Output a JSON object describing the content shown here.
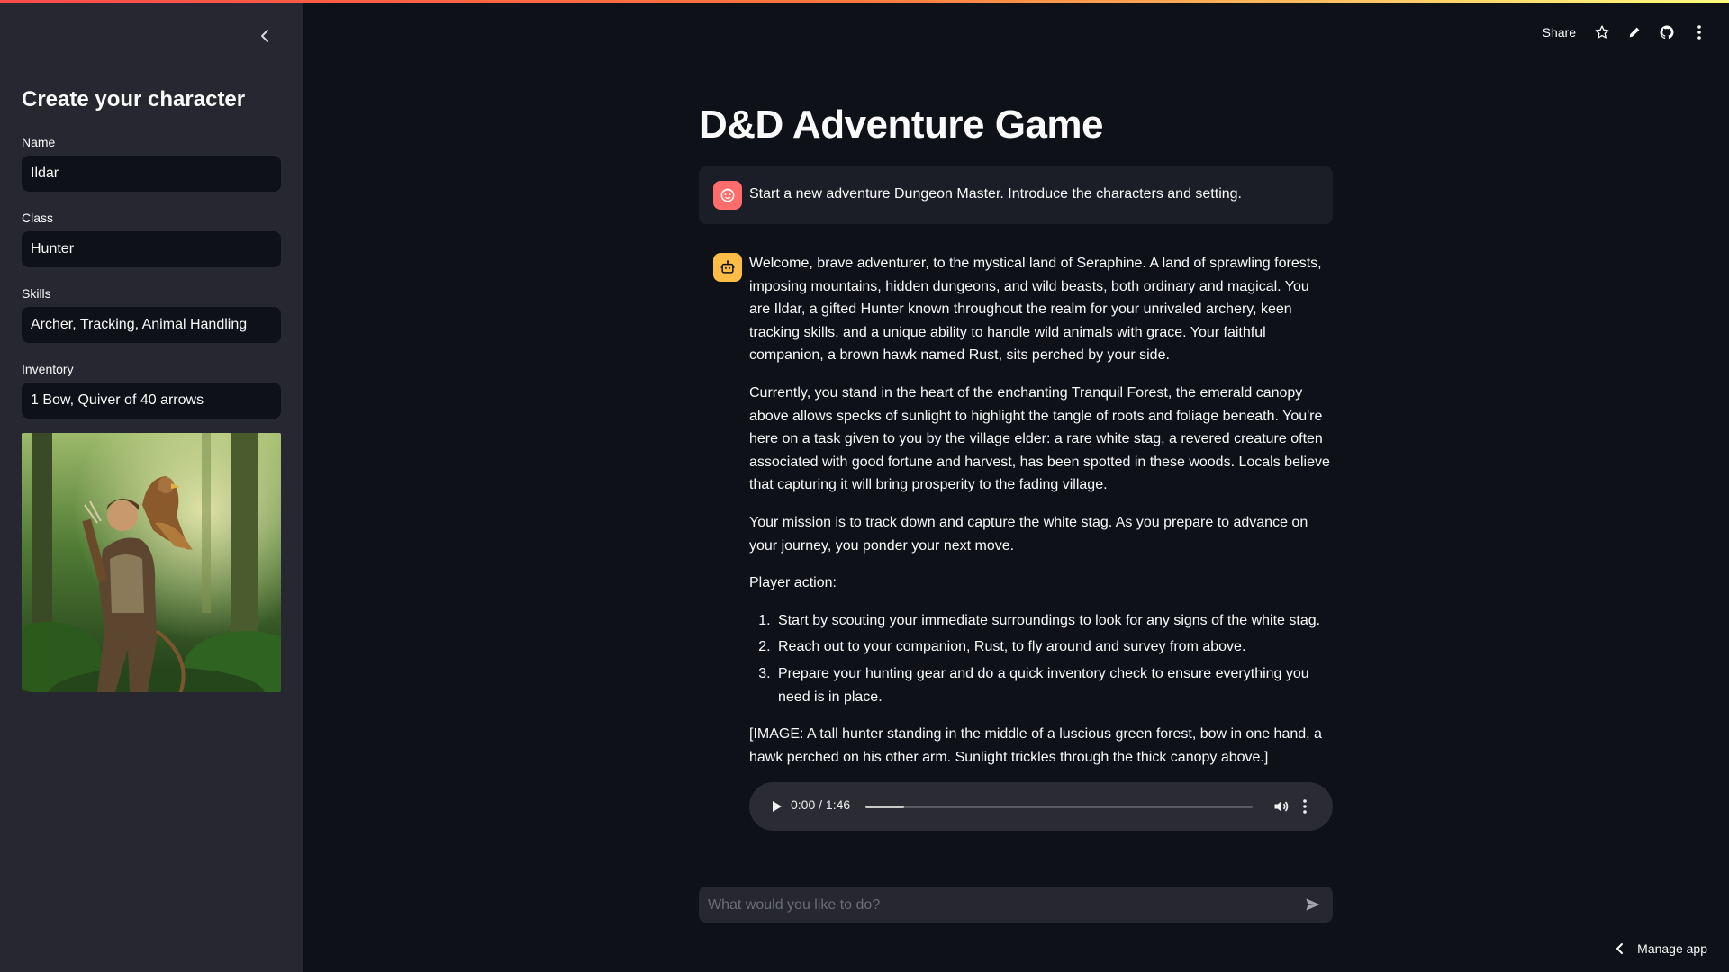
{
  "header": {
    "share_label": "Share",
    "icons": [
      "star-icon",
      "pencil-icon",
      "github-icon",
      "more-vertical-icon"
    ]
  },
  "sidebar": {
    "title": "Create your character",
    "fields": [
      {
        "label": "Name",
        "value": "Ildar"
      },
      {
        "label": "Class",
        "value": "Hunter"
      },
      {
        "label": "Skills",
        "value": "Archer, Tracking, Animal Handling"
      },
      {
        "label": "Inventory",
        "value": "1 Bow, Quiver of 40 arrows"
      }
    ],
    "portrait_icon": "hunter-with-hawk-image"
  },
  "main": {
    "title": "D&D Adventure Game",
    "user_message": "Start a new adventure Dungeon Master. Introduce the characters and setting.",
    "assistant": {
      "paragraphs": [
        "Welcome, brave adventurer, to the mystical land of Seraphine. A land of sprawling forests, imposing mountains, hidden dungeons, and wild beasts, both ordinary and magical. You are Ildar, a gifted Hunter known throughout the realm for your unrivaled archery, keen tracking skills, and a unique ability to handle wild animals with grace. Your faithful companion, a brown hawk named Rust, sits perched by your side.",
        "Currently, you stand in the heart of the enchanting Tranquil Forest, the emerald canopy above allows specks of sunlight to highlight the tangle of roots and foliage beneath. You're here on a task given to you by the village elder: a rare white stag, a revered creature often associated with good fortune and harvest, has been spotted in these woods. Locals believe that capturing it will bring prosperity to the fading village.",
        "Your mission is to track down and capture the white stag. As you prepare to advance on your journey, you ponder your next move.",
        "Player action:"
      ],
      "actions": [
        "Start by scouting your immediate surroundings to look for any signs of the white stag.",
        "Reach out to your companion, Rust, to fly around and survey from above.",
        "Prepare your hunting gear and do a quick inventory check to ensure everything you need is in place."
      ],
      "image_note": "[IMAGE: A tall hunter standing in the middle of a luscious green forest, bow in one hand, a hawk perched on his other arm. Sunlight trickles through the thick canopy above.]"
    },
    "audio": {
      "time": "0:00 / 1:46",
      "buffered_fraction": 0.1
    },
    "chat_input": {
      "placeholder": "What would you like to do?",
      "value": ""
    }
  },
  "footer": {
    "manage_app_label": "Manage app"
  },
  "colors": {
    "background": "#0e1117",
    "sidebar": "#262730",
    "user_avatar": "#ff6c6c",
    "assistant_avatar": "#ffbd45"
  }
}
